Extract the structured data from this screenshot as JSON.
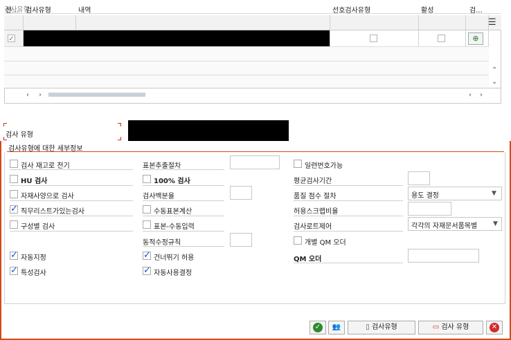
{
  "top": {
    "group_title": "검사유형",
    "columns": [
      "선...",
      "검사유형",
      "내역",
      "선호검사유형",
      "활성",
      "검..."
    ],
    "first_row_select_mark": "✓"
  },
  "middle": {
    "type_label": "검사 유형"
  },
  "details": {
    "title": "검사유형에 대한 세부정보",
    "col1": [
      {
        "label": "검사 재고로 전기",
        "checked": false
      },
      {
        "label": "HU 검사",
        "checked": false
      },
      {
        "label": "자재사양으로 검사",
        "checked": false
      },
      {
        "label": "직무리스트가있는검사",
        "checked": true
      },
      {
        "label": "구성별 검사",
        "checked": false
      },
      {
        "label": "자동지정",
        "checked": true
      },
      {
        "label": "특성검사",
        "checked": true
      }
    ],
    "col2": {
      "sample_procedure": "표본추출절차",
      "inspect_100": {
        "label": "100% 검사",
        "checked": false
      },
      "percent_inspect": "검사백분율",
      "manual_sample_calc": {
        "label": "수동표본계산",
        "checked": false
      },
      "manual_sample_entry": {
        "label": "표본-수동입력",
        "checked": false
      },
      "dynamic_rule": "동적수정규칙",
      "skip_allowed": {
        "label": "건너뛰기 허용",
        "checked": true
      },
      "auto_usage_decision": {
        "label": "자동사용결정",
        "checked": true
      }
    },
    "col3": {
      "serial_possible": {
        "label": "일련번호가능",
        "checked": false
      },
      "avg_inspection_time": "평균검사기간",
      "quality_score_procedure": "품질 점수 절차",
      "quality_score_value": "용도 결정",
      "allowed_scrap_ratio": "허용스크랩비율",
      "inspection_lot_control": "검사로트제어",
      "inspection_lot_value": "각각의 자재문서품목별",
      "individual_qm_order": {
        "label": "개별 QM 오더",
        "checked": false
      },
      "qm_order": "QM 오더"
    }
  },
  "buttons": {
    "inspection_type_btn": "검사유형",
    "inspection_type_btn2": "검사 유형"
  }
}
